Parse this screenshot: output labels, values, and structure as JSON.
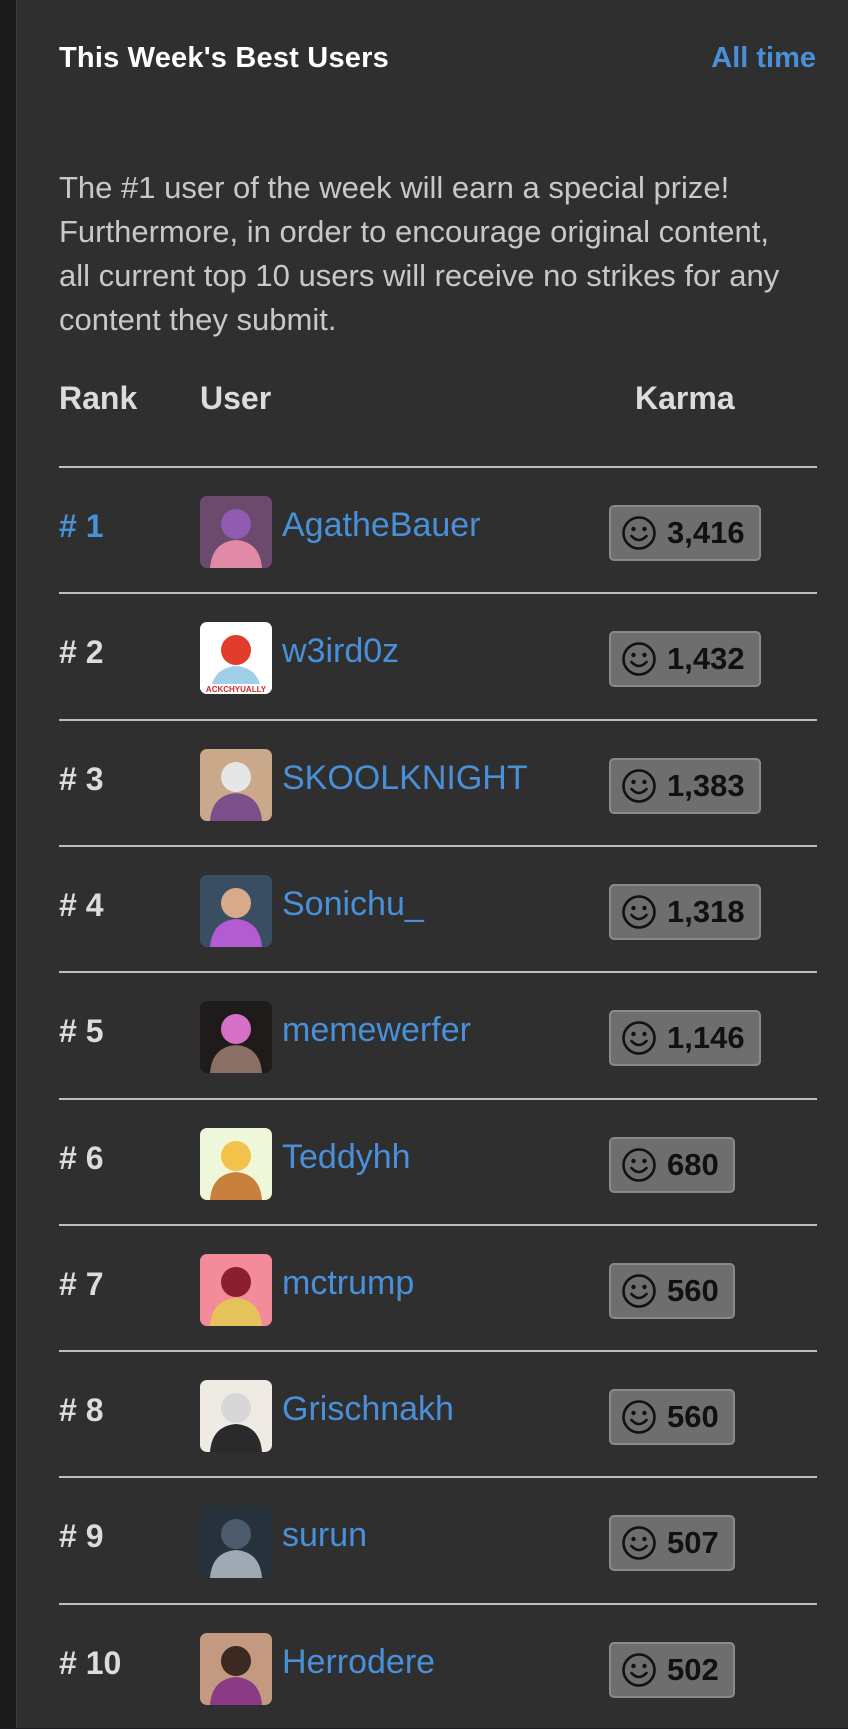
{
  "header": {
    "title": "This Week's Best Users",
    "all_time_link": "All time"
  },
  "intro_text": "The #1 user of the week will earn a special prize! Furthermore, in order to encourage original content, all current top 10 users will receive no strikes for any content they submit.",
  "columns": {
    "rank": "Rank",
    "user": "User",
    "karma": "Karma"
  },
  "karma_icon": "smiley-face-icon",
  "colors": {
    "link": "#4a90d9",
    "panel_bg": "#2f2f30",
    "badge_bg": "#6e6e6e"
  },
  "users": [
    {
      "rank": "# 1",
      "name": "AgatheBauer",
      "karma": "3,416",
      "avatar": {
        "bg": "#6b4a6e",
        "fg": "#e08aa8",
        "accent": "#8f5ab0"
      }
    },
    {
      "rank": "# 2",
      "name": "w3ird0z",
      "karma": "1,432",
      "avatar": {
        "bg": "#ffffff",
        "fg": "#9fd0e8",
        "accent": "#e23c2c",
        "label": "ACKCHYUALLY"
      }
    },
    {
      "rank": "# 3",
      "name": "SKOOLKNIGHT",
      "karma": "1,383",
      "avatar": {
        "bg": "#c9a98a",
        "fg": "#7c4f8a",
        "accent": "#e6e6e6"
      }
    },
    {
      "rank": "# 4",
      "name": "Sonichu_",
      "karma": "1,318",
      "avatar": {
        "bg": "#3a4e63",
        "fg": "#b35bd0",
        "accent": "#d9a98b"
      }
    },
    {
      "rank": "# 5",
      "name": "memewerfer",
      "karma": "1,146",
      "avatar": {
        "bg": "#1f1b1b",
        "fg": "#8a6f66",
        "accent": "#d66fc8"
      }
    },
    {
      "rank": "# 6",
      "name": "Teddyhh",
      "karma": "680",
      "avatar": {
        "bg": "#eef7d9",
        "fg": "#c8813c",
        "accent": "#f2c24a"
      }
    },
    {
      "rank": "# 7",
      "name": "mctrump",
      "karma": "560",
      "avatar": {
        "bg": "#f28c9a",
        "fg": "#e6c25a",
        "accent": "#8b1f2f"
      }
    },
    {
      "rank": "# 8",
      "name": "Grischnakh",
      "karma": "560",
      "avatar": {
        "bg": "#efeae4",
        "fg": "#2a2a2a",
        "accent": "#d7d7d7"
      }
    },
    {
      "rank": "# 9",
      "name": "surun",
      "karma": "507",
      "avatar": {
        "bg": "#27313c",
        "fg": "#9fa8b3",
        "accent": "#4b5b6b"
      }
    },
    {
      "rank": "# 10",
      "name": "Herrodere",
      "karma": "502",
      "avatar": {
        "bg": "#c39a7f",
        "fg": "#8b3a86",
        "accent": "#3b2a22"
      }
    }
  ]
}
